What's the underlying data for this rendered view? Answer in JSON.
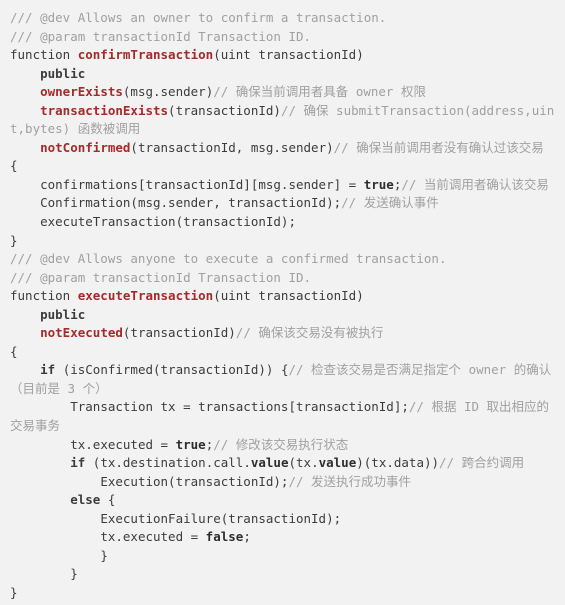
{
  "editor": {
    "language": "Solidity",
    "background_color": "#f2f2f2",
    "foreground_color": "#3c3c3c",
    "comment_color": "#a0a0a0",
    "function_name_color": "#a52a2a",
    "modifier_color": "#a52a2a",
    "keyword_color": "#3c3c3c",
    "font_size_px": 12.5,
    "line_height_px": 18.55,
    "indent_unit": "    "
  },
  "code": {
    "lines": [
      {
        "indent": 0,
        "tokens": [
          {
            "style": "comment",
            "text": "/// @dev Allows an owner to confirm a transaction."
          }
        ]
      },
      {
        "indent": 0,
        "tokens": [
          {
            "style": "comment",
            "text": "/// @param transactionId Transaction ID."
          }
        ]
      },
      {
        "indent": 0,
        "tokens": [
          {
            "style": "plain",
            "text": "function "
          },
          {
            "style": "fname",
            "text": "confirmTransaction"
          },
          {
            "style": "plain",
            "text": "(uint transactionId)"
          }
        ]
      },
      {
        "indent": 1,
        "tokens": [
          {
            "style": "keyword",
            "text": "public"
          }
        ]
      },
      {
        "indent": 1,
        "tokens": [
          {
            "style": "modifier",
            "text": "ownerExists"
          },
          {
            "style": "plain",
            "text": "(msg.sender)"
          },
          {
            "style": "comment",
            "text": "// 确保当前调用者具备 owner 权限"
          }
        ]
      },
      {
        "indent": 1,
        "tokens": [
          {
            "style": "modifier",
            "text": "transactionExists"
          },
          {
            "style": "plain",
            "text": "(transactionId)"
          },
          {
            "style": "comment",
            "text": "// 确保 submitTransaction(address,uint,bytes) 函数被调用"
          }
        ]
      },
      {
        "indent": 1,
        "tokens": [
          {
            "style": "modifier",
            "text": "notConfirmed"
          },
          {
            "style": "plain",
            "text": "(transactionId, msg.sender)"
          },
          {
            "style": "comment",
            "text": "// 确保当前调用者没有确认过该交易"
          }
        ]
      },
      {
        "indent": 0,
        "tokens": [
          {
            "style": "plain",
            "text": "{"
          }
        ]
      },
      {
        "indent": 1,
        "tokens": [
          {
            "style": "plain",
            "text": "confirmations[transactionId][msg.sender] = "
          },
          {
            "style": "literal",
            "text": "true"
          },
          {
            "style": "plain",
            "text": ";"
          },
          {
            "style": "comment",
            "text": "// 当前调用者确认该交易"
          }
        ]
      },
      {
        "indent": 1,
        "tokens": [
          {
            "style": "plain",
            "text": "Confirmation(msg.sender, transactionId);"
          },
          {
            "style": "comment",
            "text": "// 发送确认事件"
          }
        ]
      },
      {
        "indent": 1,
        "tokens": [
          {
            "style": "plain",
            "text": "executeTransaction(transactionId);"
          }
        ]
      },
      {
        "indent": 0,
        "tokens": [
          {
            "style": "plain",
            "text": "}"
          }
        ]
      },
      {
        "indent": 0,
        "tokens": [
          {
            "style": "comment",
            "text": "/// @dev Allows anyone to execute a confirmed transaction."
          }
        ]
      },
      {
        "indent": 0,
        "tokens": [
          {
            "style": "comment",
            "text": "/// @param transactionId Transaction ID."
          }
        ]
      },
      {
        "indent": 0,
        "tokens": [
          {
            "style": "plain",
            "text": "function "
          },
          {
            "style": "fname",
            "text": "executeTransaction"
          },
          {
            "style": "plain",
            "text": "(uint transactionId)"
          }
        ]
      },
      {
        "indent": 1,
        "tokens": [
          {
            "style": "keyword",
            "text": "public"
          }
        ]
      },
      {
        "indent": 1,
        "tokens": [
          {
            "style": "modifier",
            "text": "notExecuted"
          },
          {
            "style": "plain",
            "text": "(transactionId)"
          },
          {
            "style": "comment",
            "text": "// 确保该交易没有被执行"
          }
        ]
      },
      {
        "indent": 0,
        "tokens": [
          {
            "style": "plain",
            "text": "{"
          }
        ]
      },
      {
        "indent": 1,
        "tokens": [
          {
            "style": "keyword",
            "text": "if"
          },
          {
            "style": "plain",
            "text": " (isConfirmed(transactionId)) {"
          },
          {
            "style": "comment",
            "text": "// 检查该交易是否满足指定个 owner 的确认（目前是 3 个）"
          }
        ]
      },
      {
        "indent": 2,
        "tokens": [
          {
            "style": "plain",
            "text": "Transaction tx = transactions[transactionId];"
          },
          {
            "style": "comment",
            "text": "// 根据 ID 取出相应的交易事务"
          }
        ]
      },
      {
        "indent": 2,
        "tokens": [
          {
            "style": "plain",
            "text": "tx.executed = "
          },
          {
            "style": "literal",
            "text": "true"
          },
          {
            "style": "plain",
            "text": ";"
          },
          {
            "style": "comment",
            "text": "// 修改该交易执行状态"
          }
        ]
      },
      {
        "indent": 2,
        "tokens": [
          {
            "style": "keyword",
            "text": "if"
          },
          {
            "style": "plain",
            "text": " (tx.destination.call."
          },
          {
            "style": "literal",
            "text": "value"
          },
          {
            "style": "plain",
            "text": "(tx."
          },
          {
            "style": "literal",
            "text": "value"
          },
          {
            "style": "plain",
            "text": ")(tx.data))"
          },
          {
            "style": "comment",
            "text": "// 跨合约调用"
          }
        ]
      },
      {
        "indent": 3,
        "tokens": [
          {
            "style": "plain",
            "text": "Execution(transactionId);"
          },
          {
            "style": "comment",
            "text": "// 发送执行成功事件"
          }
        ]
      },
      {
        "indent": 2,
        "tokens": [
          {
            "style": "keyword",
            "text": "else"
          },
          {
            "style": "plain",
            "text": " {"
          }
        ]
      },
      {
        "indent": 3,
        "tokens": [
          {
            "style": "plain",
            "text": "ExecutionFailure(transactionId);"
          }
        ]
      },
      {
        "indent": 3,
        "tokens": [
          {
            "style": "plain",
            "text": "tx.executed = "
          },
          {
            "style": "literal",
            "text": "false"
          },
          {
            "style": "plain",
            "text": ";"
          }
        ]
      },
      {
        "indent": 3,
        "tokens": [
          {
            "style": "plain",
            "text": "}"
          }
        ]
      },
      {
        "indent": 2,
        "tokens": [
          {
            "style": "plain",
            "text": "}"
          }
        ]
      },
      {
        "indent": 0,
        "tokens": [
          {
            "style": "plain",
            "text": "}"
          }
        ]
      }
    ]
  }
}
